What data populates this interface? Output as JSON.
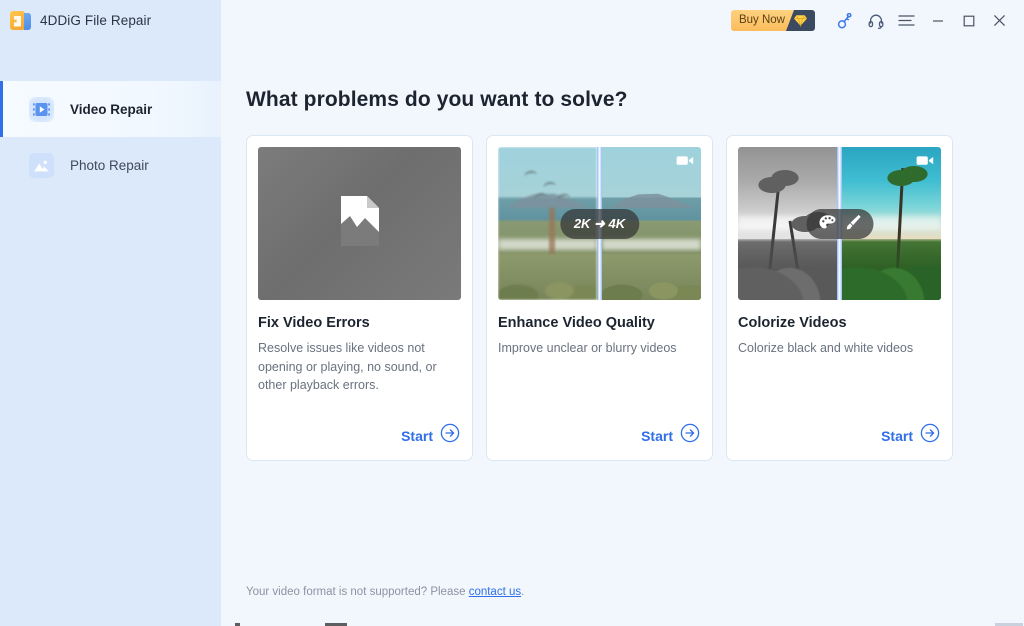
{
  "window": {
    "app_title": "4DDiG File Repair",
    "logo_icon": "app-logo-icon",
    "buy_now_label": "Buy Now",
    "gem_icon": "diamond-icon",
    "key_icon": "key-icon",
    "support_icon": "headset-icon",
    "menu_icon": "hamburger-menu-icon",
    "minimize_icon": "minimize-icon",
    "maximize_icon": "maximize-icon",
    "close_icon": "close-icon",
    "accent_color": "#2f6fe8",
    "sidebar_color": "#dce9fa",
    "background_color": "#f2f7fd",
    "buy_now_color": "#fbbc5c"
  },
  "sidebar": {
    "items": [
      {
        "label": "Video Repair",
        "icon": "video-repair-icon",
        "active": true
      },
      {
        "label": "Photo Repair",
        "icon": "photo-repair-icon",
        "active": false
      }
    ]
  },
  "main": {
    "heading": "What problems do you want to solve?",
    "cards": [
      {
        "title": "Fix Video Errors",
        "description": "Resolve issues like videos not opening or playing, no sound, or other playback errors.",
        "start_label": "Start",
        "thumb_kind": "broken-file",
        "thumb_icon": "corrupted-file-icon",
        "badge_text": "",
        "badge_icons": ""
      },
      {
        "title": "Enhance Video Quality",
        "description": "Improve unclear or blurry videos",
        "start_label": "Start",
        "thumb_kind": "beach-split",
        "thumb_icon": "video-camera-icon",
        "badge_text": "2K ➜ 4K",
        "badge_icons": ""
      },
      {
        "title": "Colorize Videos",
        "description": "Colorize black and white videos",
        "start_label": "Start",
        "thumb_kind": "palm-split",
        "thumb_icon": "video-camera-icon",
        "badge_text": "",
        "badge_icons": "palette-icon,paintbrush-icon"
      }
    ],
    "footer": {
      "text_before": "Your video format is not supported? Please ",
      "link_label": "contact us",
      "text_after": "."
    }
  }
}
